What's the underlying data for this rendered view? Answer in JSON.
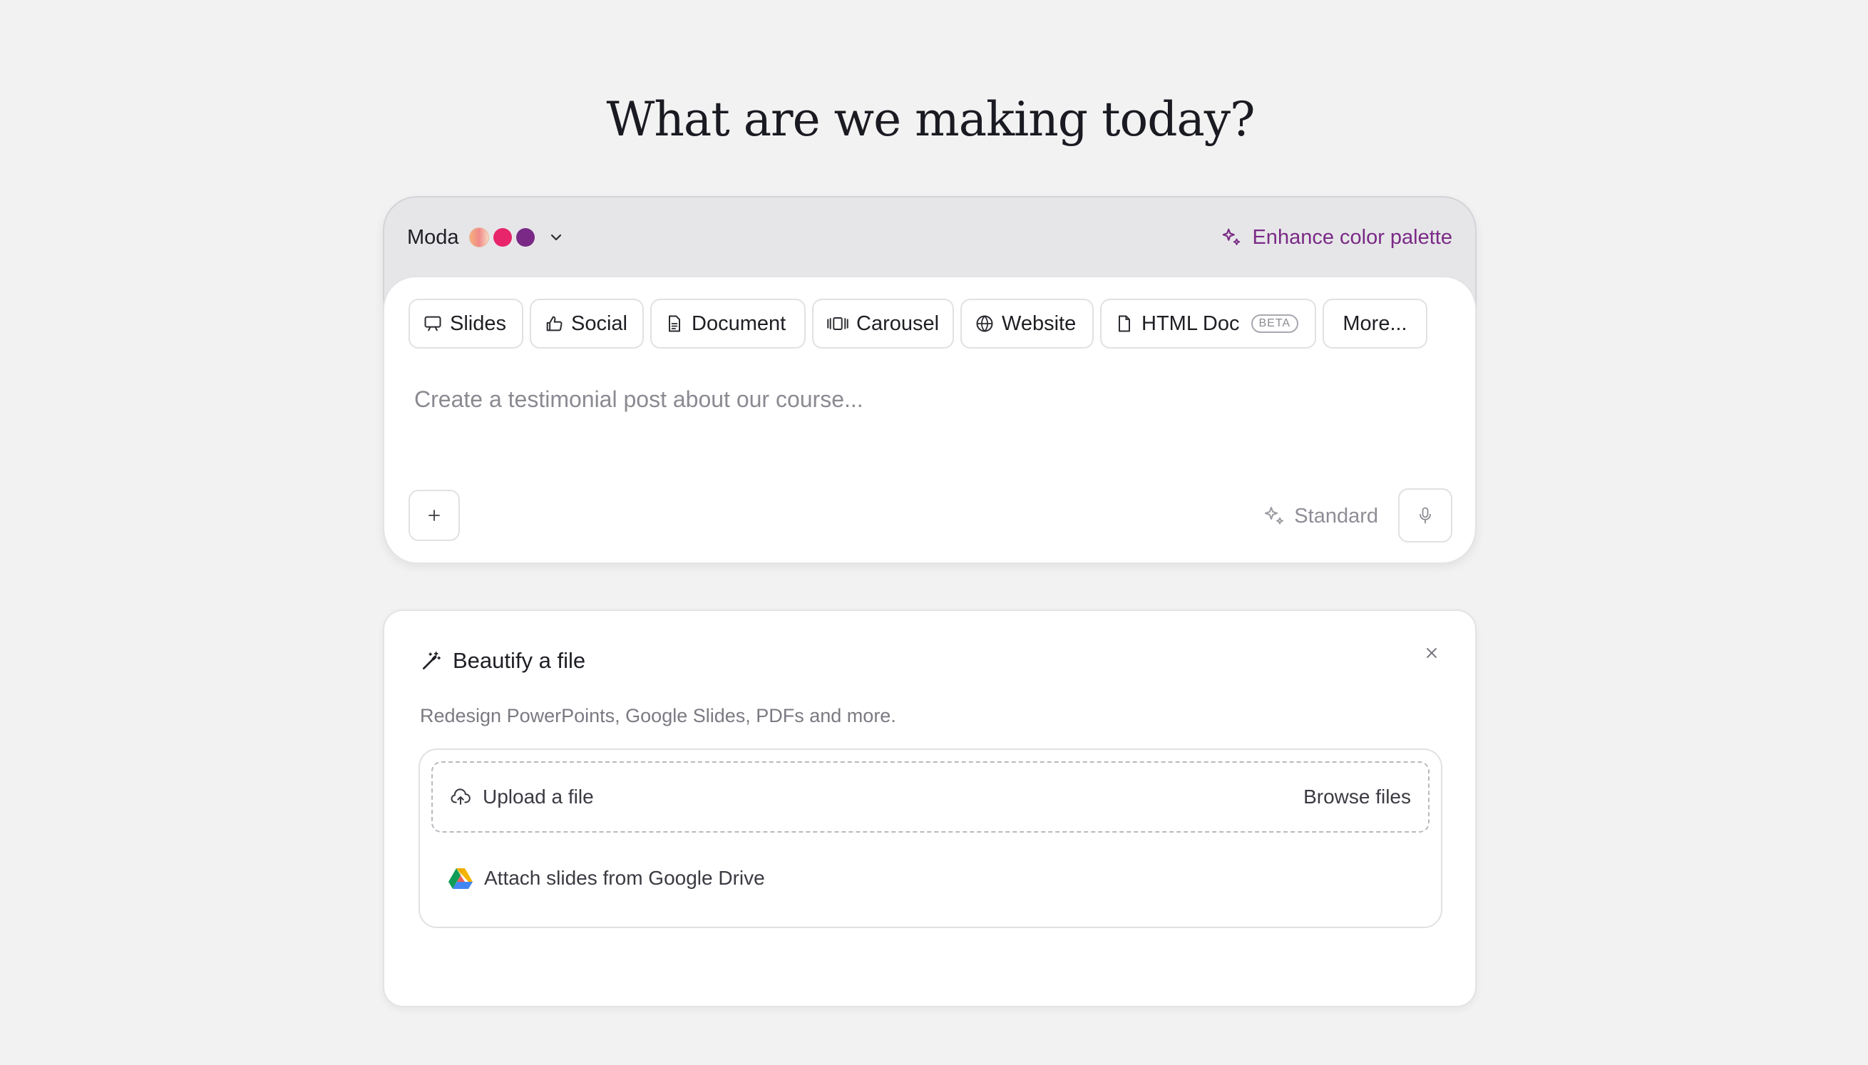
{
  "page": {
    "title": "What are we making today?"
  },
  "theme": {
    "name": "Moda",
    "swatches": [
      "#f0a15c",
      "#e8246a",
      "#7a2a86"
    ],
    "chevron_icon": "chevron-down-icon"
  },
  "enhance": {
    "label": "Enhance color palette",
    "icon": "sparkles-icon",
    "color": "#7a2a86"
  },
  "formats": [
    {
      "label": "Slides",
      "icon": "presentation-icon"
    },
    {
      "label": "Social",
      "icon": "thumbs-up-icon"
    },
    {
      "label": "Document",
      "icon": "document-icon"
    },
    {
      "label": "Carousel",
      "icon": "carousel-icon"
    },
    {
      "label": "Website",
      "icon": "globe-icon"
    },
    {
      "label": "HTML Doc",
      "icon": "file-icon",
      "badge": "BETA"
    },
    {
      "label": "More...",
      "icon": ""
    }
  ],
  "prompt": {
    "placeholder": "Create a testimonial post about our course...",
    "value": ""
  },
  "toolbar": {
    "mode_label": "Standard",
    "mode_icon": "sparkles-icon",
    "add_icon": "plus-icon",
    "mic_icon": "microphone-icon"
  },
  "beautify": {
    "title": "Beautify a file",
    "icon": "magic-wand-icon",
    "description": "Redesign PowerPoints, Google Slides, PDFs and more.",
    "upload_label": "Upload a file",
    "upload_icon": "cloud-upload-icon",
    "browse_label": "Browse files",
    "drive_label": "Attach slides from Google Drive",
    "drive_icon": "google-drive-icon",
    "close_icon": "close-icon"
  }
}
